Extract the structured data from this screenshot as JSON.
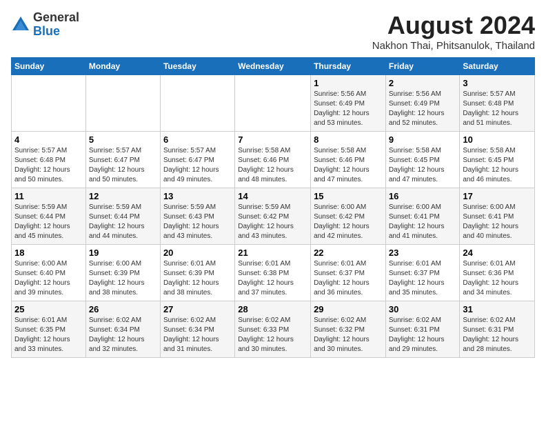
{
  "header": {
    "logo_general": "General",
    "logo_blue": "Blue",
    "month_year": "August 2024",
    "location": "Nakhon Thai, Phitsanulok, Thailand"
  },
  "weekdays": [
    "Sunday",
    "Monday",
    "Tuesday",
    "Wednesday",
    "Thursday",
    "Friday",
    "Saturday"
  ],
  "weeks": [
    {
      "days": [
        {
          "num": "",
          "info": ""
        },
        {
          "num": "",
          "info": ""
        },
        {
          "num": "",
          "info": ""
        },
        {
          "num": "",
          "info": ""
        },
        {
          "num": "1",
          "info": "Sunrise: 5:56 AM\nSunset: 6:49 PM\nDaylight: 12 hours\nand 53 minutes."
        },
        {
          "num": "2",
          "info": "Sunrise: 5:56 AM\nSunset: 6:49 PM\nDaylight: 12 hours\nand 52 minutes."
        },
        {
          "num": "3",
          "info": "Sunrise: 5:57 AM\nSunset: 6:48 PM\nDaylight: 12 hours\nand 51 minutes."
        }
      ]
    },
    {
      "days": [
        {
          "num": "4",
          "info": "Sunrise: 5:57 AM\nSunset: 6:48 PM\nDaylight: 12 hours\nand 50 minutes."
        },
        {
          "num": "5",
          "info": "Sunrise: 5:57 AM\nSunset: 6:47 PM\nDaylight: 12 hours\nand 50 minutes."
        },
        {
          "num": "6",
          "info": "Sunrise: 5:57 AM\nSunset: 6:47 PM\nDaylight: 12 hours\nand 49 minutes."
        },
        {
          "num": "7",
          "info": "Sunrise: 5:58 AM\nSunset: 6:46 PM\nDaylight: 12 hours\nand 48 minutes."
        },
        {
          "num": "8",
          "info": "Sunrise: 5:58 AM\nSunset: 6:46 PM\nDaylight: 12 hours\nand 47 minutes."
        },
        {
          "num": "9",
          "info": "Sunrise: 5:58 AM\nSunset: 6:45 PM\nDaylight: 12 hours\nand 47 minutes."
        },
        {
          "num": "10",
          "info": "Sunrise: 5:58 AM\nSunset: 6:45 PM\nDaylight: 12 hours\nand 46 minutes."
        }
      ]
    },
    {
      "days": [
        {
          "num": "11",
          "info": "Sunrise: 5:59 AM\nSunset: 6:44 PM\nDaylight: 12 hours\nand 45 minutes."
        },
        {
          "num": "12",
          "info": "Sunrise: 5:59 AM\nSunset: 6:44 PM\nDaylight: 12 hours\nand 44 minutes."
        },
        {
          "num": "13",
          "info": "Sunrise: 5:59 AM\nSunset: 6:43 PM\nDaylight: 12 hours\nand 43 minutes."
        },
        {
          "num": "14",
          "info": "Sunrise: 5:59 AM\nSunset: 6:42 PM\nDaylight: 12 hours\nand 43 minutes."
        },
        {
          "num": "15",
          "info": "Sunrise: 6:00 AM\nSunset: 6:42 PM\nDaylight: 12 hours\nand 42 minutes."
        },
        {
          "num": "16",
          "info": "Sunrise: 6:00 AM\nSunset: 6:41 PM\nDaylight: 12 hours\nand 41 minutes."
        },
        {
          "num": "17",
          "info": "Sunrise: 6:00 AM\nSunset: 6:41 PM\nDaylight: 12 hours\nand 40 minutes."
        }
      ]
    },
    {
      "days": [
        {
          "num": "18",
          "info": "Sunrise: 6:00 AM\nSunset: 6:40 PM\nDaylight: 12 hours\nand 39 minutes."
        },
        {
          "num": "19",
          "info": "Sunrise: 6:00 AM\nSunset: 6:39 PM\nDaylight: 12 hours\nand 38 minutes."
        },
        {
          "num": "20",
          "info": "Sunrise: 6:01 AM\nSunset: 6:39 PM\nDaylight: 12 hours\nand 38 minutes."
        },
        {
          "num": "21",
          "info": "Sunrise: 6:01 AM\nSunset: 6:38 PM\nDaylight: 12 hours\nand 37 minutes."
        },
        {
          "num": "22",
          "info": "Sunrise: 6:01 AM\nSunset: 6:37 PM\nDaylight: 12 hours\nand 36 minutes."
        },
        {
          "num": "23",
          "info": "Sunrise: 6:01 AM\nSunset: 6:37 PM\nDaylight: 12 hours\nand 35 minutes."
        },
        {
          "num": "24",
          "info": "Sunrise: 6:01 AM\nSunset: 6:36 PM\nDaylight: 12 hours\nand 34 minutes."
        }
      ]
    },
    {
      "days": [
        {
          "num": "25",
          "info": "Sunrise: 6:01 AM\nSunset: 6:35 PM\nDaylight: 12 hours\nand 33 minutes."
        },
        {
          "num": "26",
          "info": "Sunrise: 6:02 AM\nSunset: 6:34 PM\nDaylight: 12 hours\nand 32 minutes."
        },
        {
          "num": "27",
          "info": "Sunrise: 6:02 AM\nSunset: 6:34 PM\nDaylight: 12 hours\nand 31 minutes."
        },
        {
          "num": "28",
          "info": "Sunrise: 6:02 AM\nSunset: 6:33 PM\nDaylight: 12 hours\nand 30 minutes."
        },
        {
          "num": "29",
          "info": "Sunrise: 6:02 AM\nSunset: 6:32 PM\nDaylight: 12 hours\nand 30 minutes."
        },
        {
          "num": "30",
          "info": "Sunrise: 6:02 AM\nSunset: 6:31 PM\nDaylight: 12 hours\nand 29 minutes."
        },
        {
          "num": "31",
          "info": "Sunrise: 6:02 AM\nSunset: 6:31 PM\nDaylight: 12 hours\nand 28 minutes."
        }
      ]
    }
  ]
}
